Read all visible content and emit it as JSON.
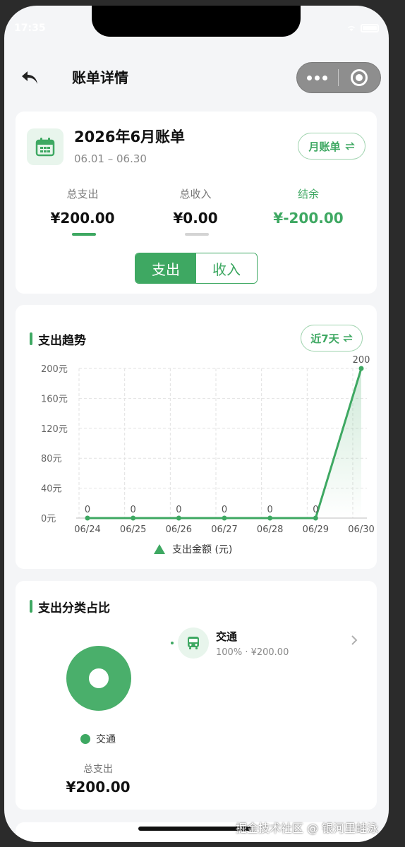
{
  "status_bar": {
    "time": "17:35"
  },
  "navbar": {
    "title": "账单详情"
  },
  "bill": {
    "title": "2026年6月账单",
    "range": "06.01 – 06.30",
    "toggle_label": "月账单",
    "toggle_icon": "switch-arrows-icon",
    "summary": [
      {
        "label": "总支出",
        "value": "¥200.00"
      },
      {
        "label": "总收入",
        "value": "¥0.00"
      },
      {
        "label": "结余",
        "value": "¥-200.00"
      }
    ],
    "segment": {
      "active": "支出",
      "inactive": "收入"
    }
  },
  "trend": {
    "title": "支出趋势",
    "range_label": "近7天"
  },
  "chart_data": {
    "type": "line",
    "categories": [
      "06/24",
      "06/25",
      "06/26",
      "06/27",
      "06/28",
      "06/29",
      "06/30"
    ],
    "series": [
      {
        "name": "支出金额 (元)",
        "values": [
          0,
          0,
          0,
          0,
          0,
          0,
          200
        ],
        "data_labels": [
          "0",
          "0",
          "0",
          "0",
          "0",
          "0",
          "200"
        ]
      }
    ],
    "y_ticks": [
      "0元",
      "40元",
      "80元",
      "120元",
      "160元",
      "200元"
    ],
    "ylim": [
      0,
      200
    ],
    "grid": true,
    "legend_position": "bottom",
    "color": "#3ea862"
  },
  "category": {
    "title": "支出分类占比",
    "items": [
      {
        "name": "交通",
        "percent": "100%",
        "amount": "¥200.00",
        "separator": "·",
        "icon": "bus-icon"
      }
    ],
    "legend_label": "交通",
    "total_label": "总支出",
    "total_value": "¥200.00"
  },
  "watermark": "掘金技术社区 @ 银河里蛙泳"
}
